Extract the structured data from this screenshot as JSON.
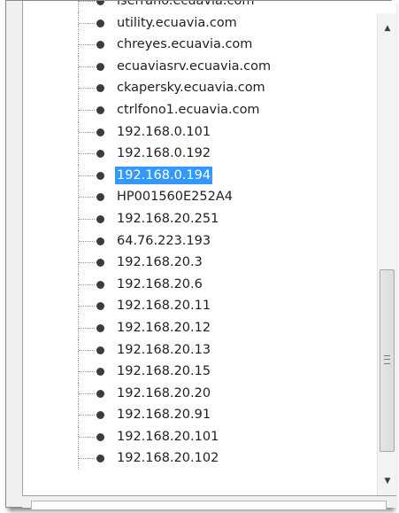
{
  "tree": {
    "selected_index": 7,
    "items": [
      {
        "label": "iserrano.ecuavia.com"
      },
      {
        "label": "utility.ecuavia.com"
      },
      {
        "label": "chreyes.ecuavia.com"
      },
      {
        "label": "ecuaviasrv.ecuavia.com"
      },
      {
        "label": "ckapersky.ecuavia.com"
      },
      {
        "label": "ctrlfono1.ecuavia.com"
      },
      {
        "label": "192.168.0.101"
      },
      {
        "label": "192.168.0.192"
      },
      {
        "label": "192.168.0.194"
      },
      {
        "label": "HP001560E252A4"
      },
      {
        "label": "192.168.20.251"
      },
      {
        "label": "64.76.223.193"
      },
      {
        "label": "192.168.20.3"
      },
      {
        "label": "192.168.20.6"
      },
      {
        "label": "192.168.20.11"
      },
      {
        "label": "192.168.20.12"
      },
      {
        "label": "192.168.20.13"
      },
      {
        "label": "192.168.20.15"
      },
      {
        "label": "192.168.20.20"
      },
      {
        "label": "192.168.20.91"
      },
      {
        "label": "192.168.20.101"
      },
      {
        "label": "192.168.20.102"
      }
    ]
  },
  "scrollbar": {
    "up_icon": "arrow-up-icon",
    "down_icon": "arrow-down-icon",
    "position_fraction": 0.58
  },
  "colors": {
    "selection": "#3399ff",
    "selection_text": "#ffffff"
  }
}
